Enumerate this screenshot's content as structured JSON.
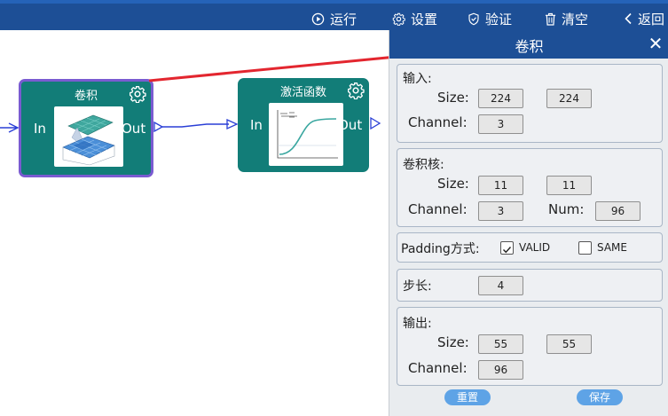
{
  "toolbar": {
    "run": "运行",
    "settings": "设置",
    "verify": "验证",
    "clear": "清空",
    "back": "返回"
  },
  "nodes": {
    "conv": {
      "title": "卷积",
      "in": "In",
      "out": "Out"
    },
    "activation": {
      "title": "激活函数",
      "in": "In",
      "out": "Out"
    }
  },
  "panel": {
    "title": "卷积",
    "input": {
      "section": "输入:",
      "size_label": "Size:",
      "size_w": "224",
      "size_h": "224",
      "channel_label": "Channel:",
      "channel": "3"
    },
    "kernel": {
      "section": "卷积核:",
      "size_label": "Size:",
      "size_w": "11",
      "size_h": "11",
      "channel_label": "Channel:",
      "channel": "3",
      "num_label": "Num:",
      "num": "96"
    },
    "padding": {
      "label": "Padding方式:",
      "valid": "VALID",
      "valid_checked": true,
      "same": "SAME",
      "same_checked": false
    },
    "stride": {
      "label": "步长:",
      "value": "4"
    },
    "output": {
      "section": "输出:",
      "size_label": "Size:",
      "size_w": "55",
      "size_h": "55",
      "channel_label": "Channel:",
      "channel": "96"
    },
    "reset": "重置",
    "save": "保存"
  },
  "colors": {
    "toolbar": "#1d4f96",
    "node": "#127d78",
    "node_selected_border": "#7a5bd1",
    "link": "#2a3fd6",
    "arrow": "#e3262f",
    "button": "#5ea3e6"
  }
}
